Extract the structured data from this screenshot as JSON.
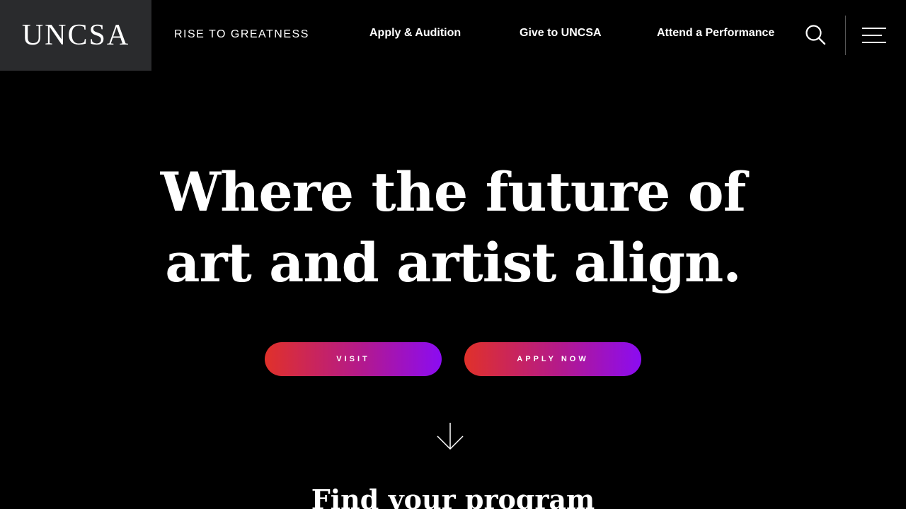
{
  "header": {
    "logo": "UNCSA",
    "tagline": "RISE TO GREATNESS",
    "nav": [
      {
        "label": "Apply & Audition"
      },
      {
        "label": "Give to UNCSA"
      },
      {
        "label": "Attend a Performance"
      }
    ],
    "icons": {
      "search": "search-icon",
      "menu": "hamburger-menu-icon"
    }
  },
  "hero": {
    "title_line1": "Where the future of",
    "title_line2": "art and artist align.",
    "buttons": {
      "visit": "VISIT",
      "apply": "APPLY NOW"
    },
    "scroll_icon": "arrow-down-icon"
  },
  "section": {
    "title": "Find your program"
  },
  "colors": {
    "background": "#000000",
    "logo_box": "#2a2b2d",
    "gradient_start": "#e0312a",
    "gradient_end": "#8b0cf2",
    "text": "#ffffff"
  }
}
